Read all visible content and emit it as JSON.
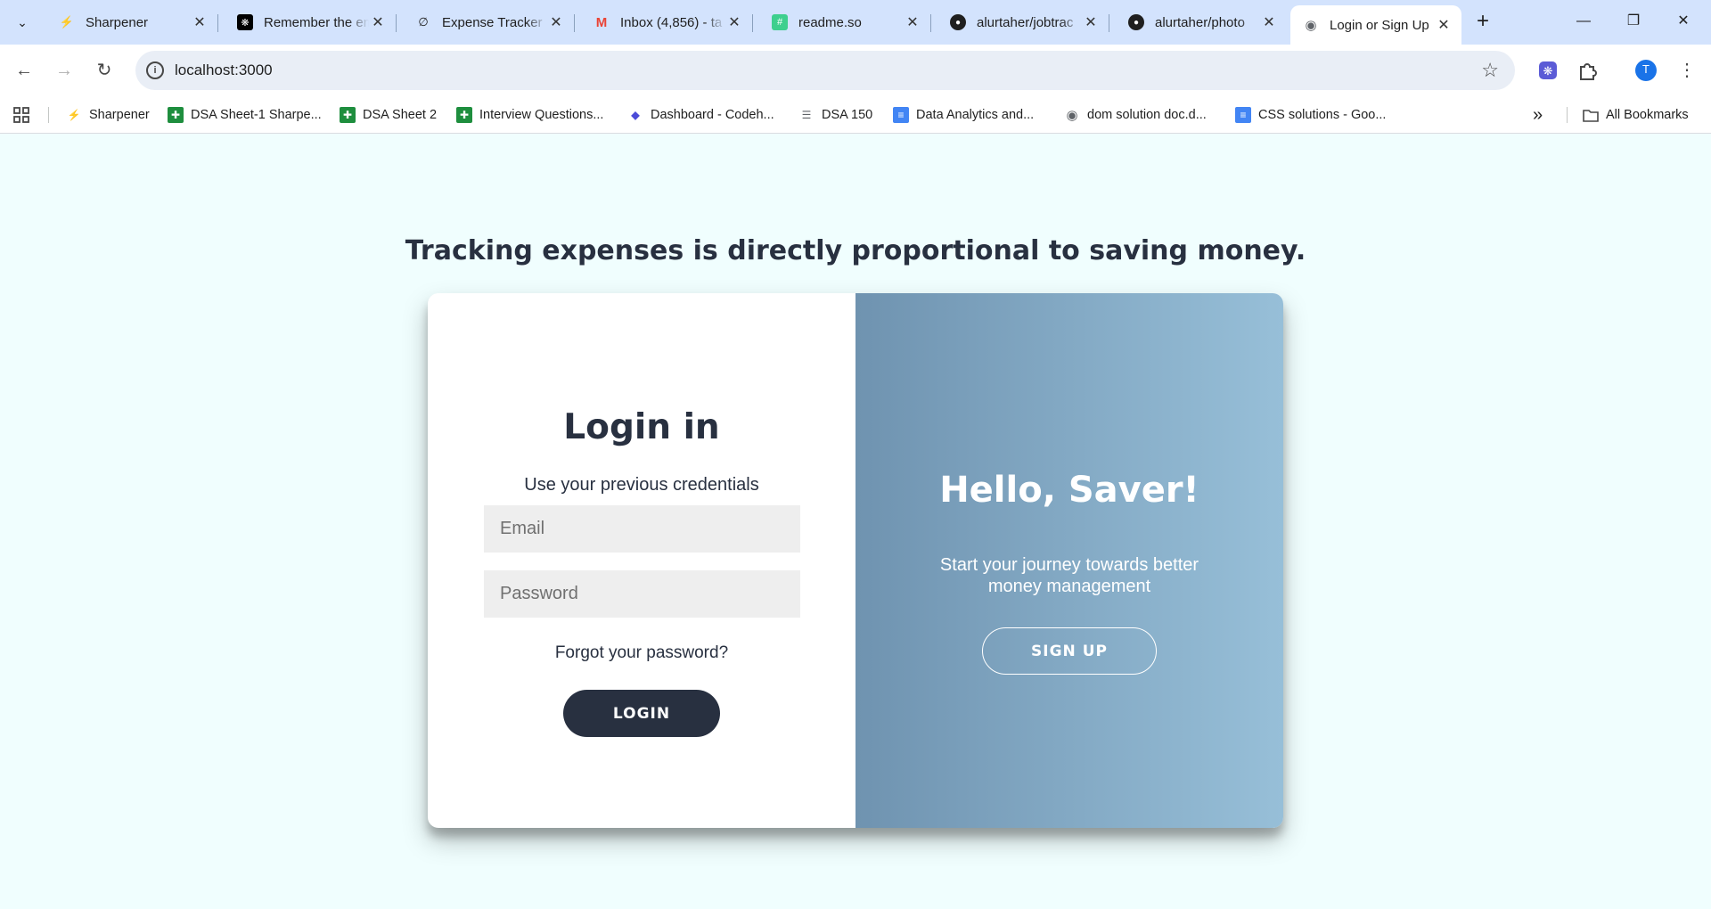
{
  "browser": {
    "tabs": [
      {
        "title": "Sharpener",
        "icon": "sharpener-bolt-icon",
        "active": false
      },
      {
        "title": "Remember the email",
        "icon": "openai-icon",
        "active": false
      },
      {
        "title": "Expense Tracker",
        "icon": "sync-icon",
        "active": false
      },
      {
        "title": "Inbox (4,856) - ta",
        "icon": "gmail-icon",
        "active": false
      },
      {
        "title": "readme.so",
        "icon": "readme-icon",
        "active": false
      },
      {
        "title": "alurtaher/jobtrac",
        "icon": "github-icon",
        "active": false
      },
      {
        "title": "alurtaher/photo",
        "icon": "github-icon",
        "active": false
      },
      {
        "title": "Login or Sign Up",
        "icon": "globe-icon",
        "active": true
      }
    ],
    "new_tab": "+",
    "url": "localhost:3000",
    "profile_initial": "T",
    "bookmarks": [
      {
        "label": "Sharpener",
        "icon": "sharpener-bolt-icon"
      },
      {
        "label": "DSA Sheet-1 Sharpe...",
        "icon": "sheets-icon"
      },
      {
        "label": "DSA Sheet 2",
        "icon": "sheets-icon"
      },
      {
        "label": "Interview Questions...",
        "icon": "sheets-icon"
      },
      {
        "label": "Dashboard - Codeh...",
        "icon": "codehelp-icon"
      },
      {
        "label": "DSA 150",
        "icon": "checklist-icon"
      },
      {
        "label": "Data Analytics and...",
        "icon": "docs-icon"
      },
      {
        "label": "dom solution doc.d...",
        "icon": "globe-icon"
      },
      {
        "label": "CSS solutions - Goo...",
        "icon": "docs-icon"
      }
    ],
    "all_bookmarks": "All Bookmarks",
    "overflow": "»"
  },
  "page": {
    "headline": "Tracking expenses is directly proportional to saving money.",
    "login": {
      "title": "Login in",
      "subtitle": "Use your previous credentials",
      "email_placeholder": "Email",
      "password_placeholder": "Password",
      "forgot": "Forgot your password?",
      "button": "LOGIN"
    },
    "signup": {
      "title": "Hello, Saver!",
      "subtitle": "Start your journey towards better money management",
      "button": "SIGN UP"
    }
  },
  "colors": {
    "page_bg": "#f0fefe",
    "dark": "#283040",
    "panel_gradient_start": "#6f93b0",
    "panel_gradient_end": "#97bfd8",
    "tabstrip": "#d3e3fd"
  }
}
